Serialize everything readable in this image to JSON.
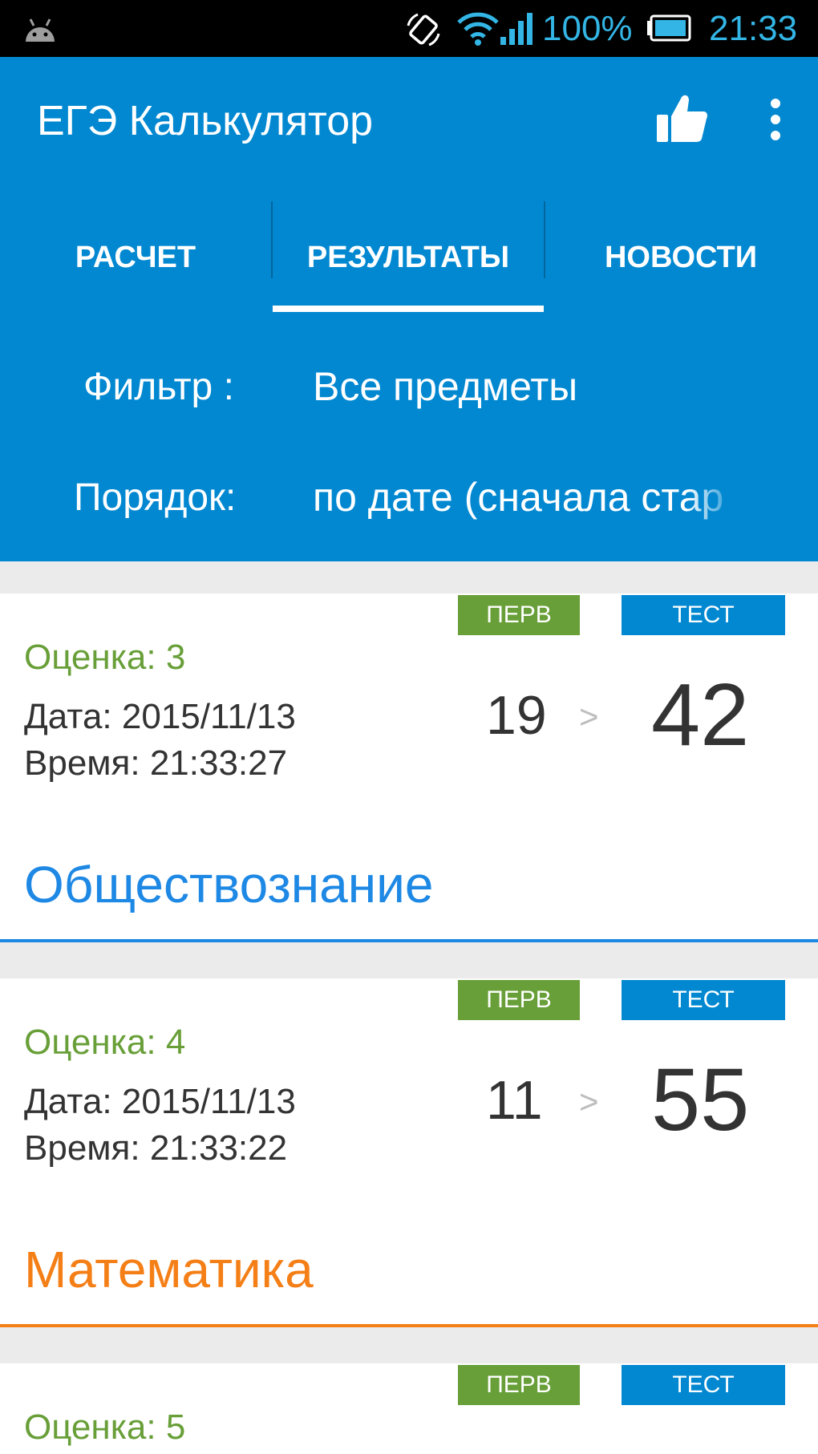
{
  "status_bar": {
    "battery_percent": "100%",
    "time": "21:33",
    "icons": [
      "android-icon",
      "auto-rotate-icon",
      "wifi-icon",
      "cell-signal-icon",
      "battery-icon"
    ]
  },
  "action_bar": {
    "title": "ЕГЭ Калькулятор",
    "icons": [
      "thumbs-up-icon",
      "overflow-menu-icon"
    ]
  },
  "tabs": [
    {
      "label": "РАСЧЕТ",
      "selected": false
    },
    {
      "label": "РЕЗУЛЬТАТЫ",
      "selected": true
    },
    {
      "label": "НОВОСТИ",
      "selected": false
    }
  ],
  "filter": {
    "label": "Фильтр :",
    "value": "Все предметы"
  },
  "order": {
    "label": "Порядок:",
    "value": "по дате (сначала стар"
  },
  "colors": {
    "primary": "#0288d1",
    "green": "#689f38",
    "orange": "#f57f17",
    "blue_subject": "#1e88e5"
  },
  "results": [
    {
      "badge_first": "ПЕРВ",
      "badge_test": "ТЕСТ",
      "grade": "Оценка: 3",
      "date": "Дата: 2015/11/13",
      "time": "Время: 21:33:27",
      "primary_score": "19",
      "arrow": ">",
      "test_score": "42",
      "subject": "Обществознание",
      "subject_color": "#1e88e5"
    },
    {
      "badge_first": "ПЕРВ",
      "badge_test": "ТЕСТ",
      "grade": "Оценка: 4",
      "date": "Дата: 2015/11/13",
      "time": "Время: 21:33:22",
      "primary_score": "11",
      "arrow": ">",
      "test_score": "55",
      "subject": "Математика",
      "subject_color": "#f57f17"
    },
    {
      "badge_first": "ПЕРВ",
      "badge_test": "ТЕСТ",
      "grade": "Оценка: 5"
    }
  ]
}
